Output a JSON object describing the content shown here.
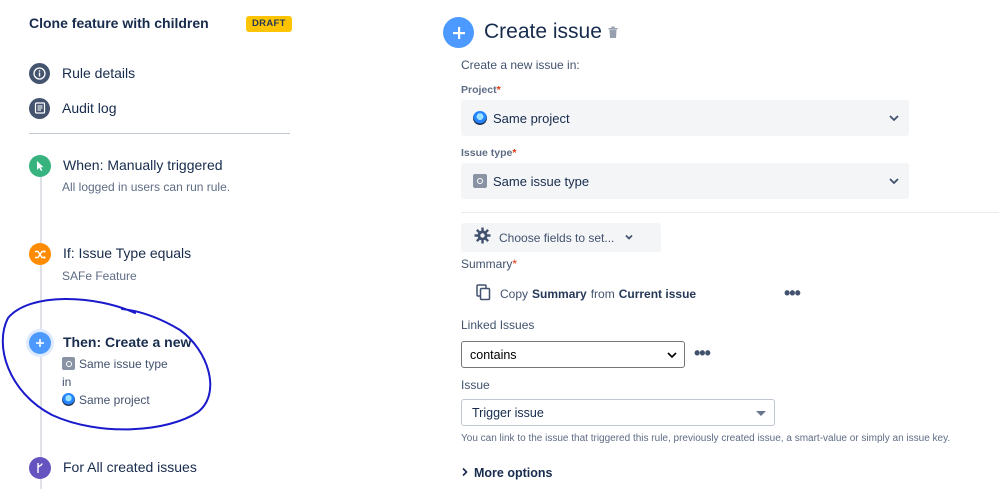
{
  "rule": {
    "title": "Clone feature with children",
    "badge": "DRAFT"
  },
  "nav": [
    {
      "label": "Rule details",
      "icon": "info-icon"
    },
    {
      "label": "Audit log",
      "icon": "audit-log-icon"
    }
  ],
  "steps": {
    "trigger": {
      "title": "When: Manually triggered",
      "sub": "All logged in users can run rule.",
      "icon": "cursor-icon",
      "color": "#36B37E"
    },
    "condition": {
      "title": "If: Issue Type equals",
      "sub": "SAFe Feature",
      "icon": "shuffle-icon",
      "color": "#FF8B00"
    },
    "action": {
      "title": "Then: Create a new",
      "line1": "Same issue type",
      "line2": "in",
      "line3": "Same project",
      "icon": "plus-icon",
      "color": "#4C9AFF"
    },
    "branch": {
      "title": "For All created issues",
      "icon": "branch-icon",
      "color": "#6554C0"
    }
  },
  "panel": {
    "title": "Create issue",
    "intro": "Create a new issue in:",
    "project_label": "Project",
    "project_value": "Same project",
    "issue_type_label": "Issue type",
    "issue_type_value": "Same issue type",
    "choose_fields": "Choose fields to set...",
    "summary_label": "Summary",
    "copy_prefix": "Copy",
    "copy_field": "Summary",
    "copy_from": "from",
    "copy_source": "Current issue",
    "linked_issues_label": "Linked Issues",
    "linked_issues_value": "contains",
    "issue_label": "Issue",
    "issue_value": "Trigger issue",
    "help_text": "You can link to the issue that triggered this rule, previously created issue, a smart-value or simply an issue key.",
    "more_options": "More options",
    "required_marker": "*",
    "more_dots": "•••"
  },
  "colors": {
    "accent": "#4C9AFF",
    "draft": "#FFC400",
    "annotation": "#1A1ACC"
  }
}
